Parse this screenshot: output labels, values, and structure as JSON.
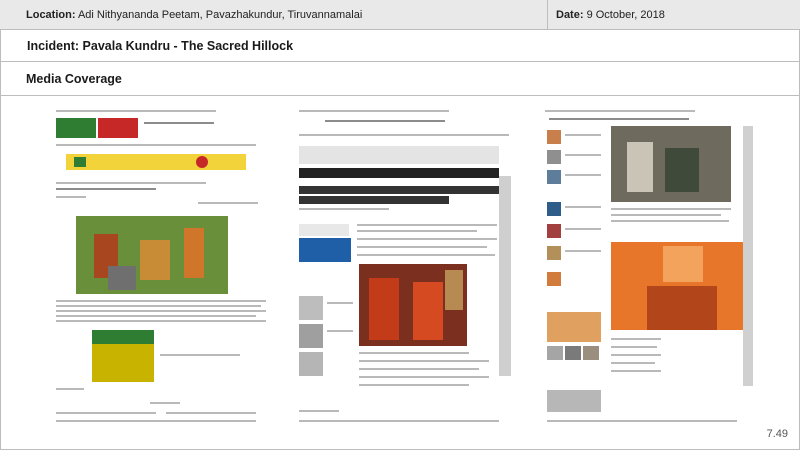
{
  "header": {
    "location_label": "Location:",
    "location_value": "Adi Nithyananda Peetam, Pavazhakundur, Tiruvannamalai",
    "date_label": "Date:",
    "date_value": "9 October, 2018"
  },
  "incident": "Incident: Pavala Kundru - The Sacred Hillock",
  "section": "Media Coverage",
  "page_number": "7.49"
}
